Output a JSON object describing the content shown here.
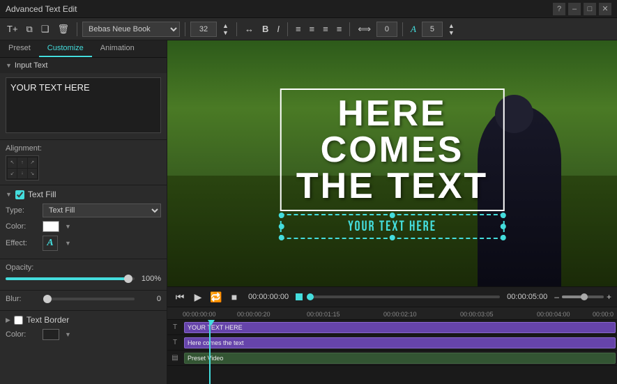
{
  "titleBar": {
    "title": "Advanced Text Edit",
    "helpBtn": "?",
    "minimizeBtn": "–",
    "restoreBtn": "□",
    "closeBtn": "✕"
  },
  "toolbar": {
    "addTextBtn": "T+",
    "copyBtn": "⧉",
    "pasteBtn": "⧉",
    "deleteBtn": "🗑",
    "fontFamily": "Bebas Neue Book",
    "fontSize": "32",
    "trackingBtn": "↔",
    "boldBtn": "B",
    "italicBtn": "I",
    "alignLeftBtn": "≡",
    "alignCenterBtn": "≡",
    "alignRightBtn": "≡",
    "justifyBtn": "≡",
    "spacingBtn": "⟺",
    "opacityValue": "0",
    "textEffectBtn": "A",
    "textEffectValue": "5"
  },
  "leftPanel": {
    "tabs": [
      "Preset",
      "Customize",
      "Animation"
    ],
    "activeTab": "Customize",
    "inputText": {
      "sectionLabel": "Input Text",
      "value": "YOUR TEXT HERE"
    },
    "alignment": {
      "label": "Alignment:"
    },
    "textFill": {
      "label": "Text Fill",
      "checked": true,
      "typeLabel": "Type:",
      "typeValue": "Text Fill",
      "colorLabel": "Color:",
      "effectLabel": "Effect:",
      "effectSymbol": "A"
    },
    "opacity": {
      "label": "Opacity:",
      "value": "100%",
      "sliderPos": 95
    },
    "blur": {
      "label": "Blur:",
      "value": "0",
      "sliderPos": 0
    },
    "textBorder": {
      "label": "Text Border",
      "checked": false,
      "colorLabel": "Color:"
    }
  },
  "videoPreview": {
    "mainText": "HERE COMES THE TEXT",
    "subText": "YOUR TEXT HERE"
  },
  "playback": {
    "currentTime": "00:00:00:00",
    "totalTime": "00:00:05:00",
    "zoomMinus": "–",
    "zoomPlus": "+"
  },
  "timeline": {
    "rulerMarks": [
      "00:00:00:00",
      "00:00:00:20",
      "00:00:01:15",
      "00:00:02:10",
      "00:00:03:05",
      "00:00:04:00",
      "00:00:0"
    ],
    "tracks": [
      {
        "icon": "T",
        "clipLabel": "YOUR TEXT HERE",
        "type": "purple"
      },
      {
        "icon": "T",
        "clipLabel": "Here comes the text",
        "type": "purple"
      },
      {
        "icon": "▤",
        "clipLabel": "Preset Video",
        "type": "green"
      }
    ]
  }
}
